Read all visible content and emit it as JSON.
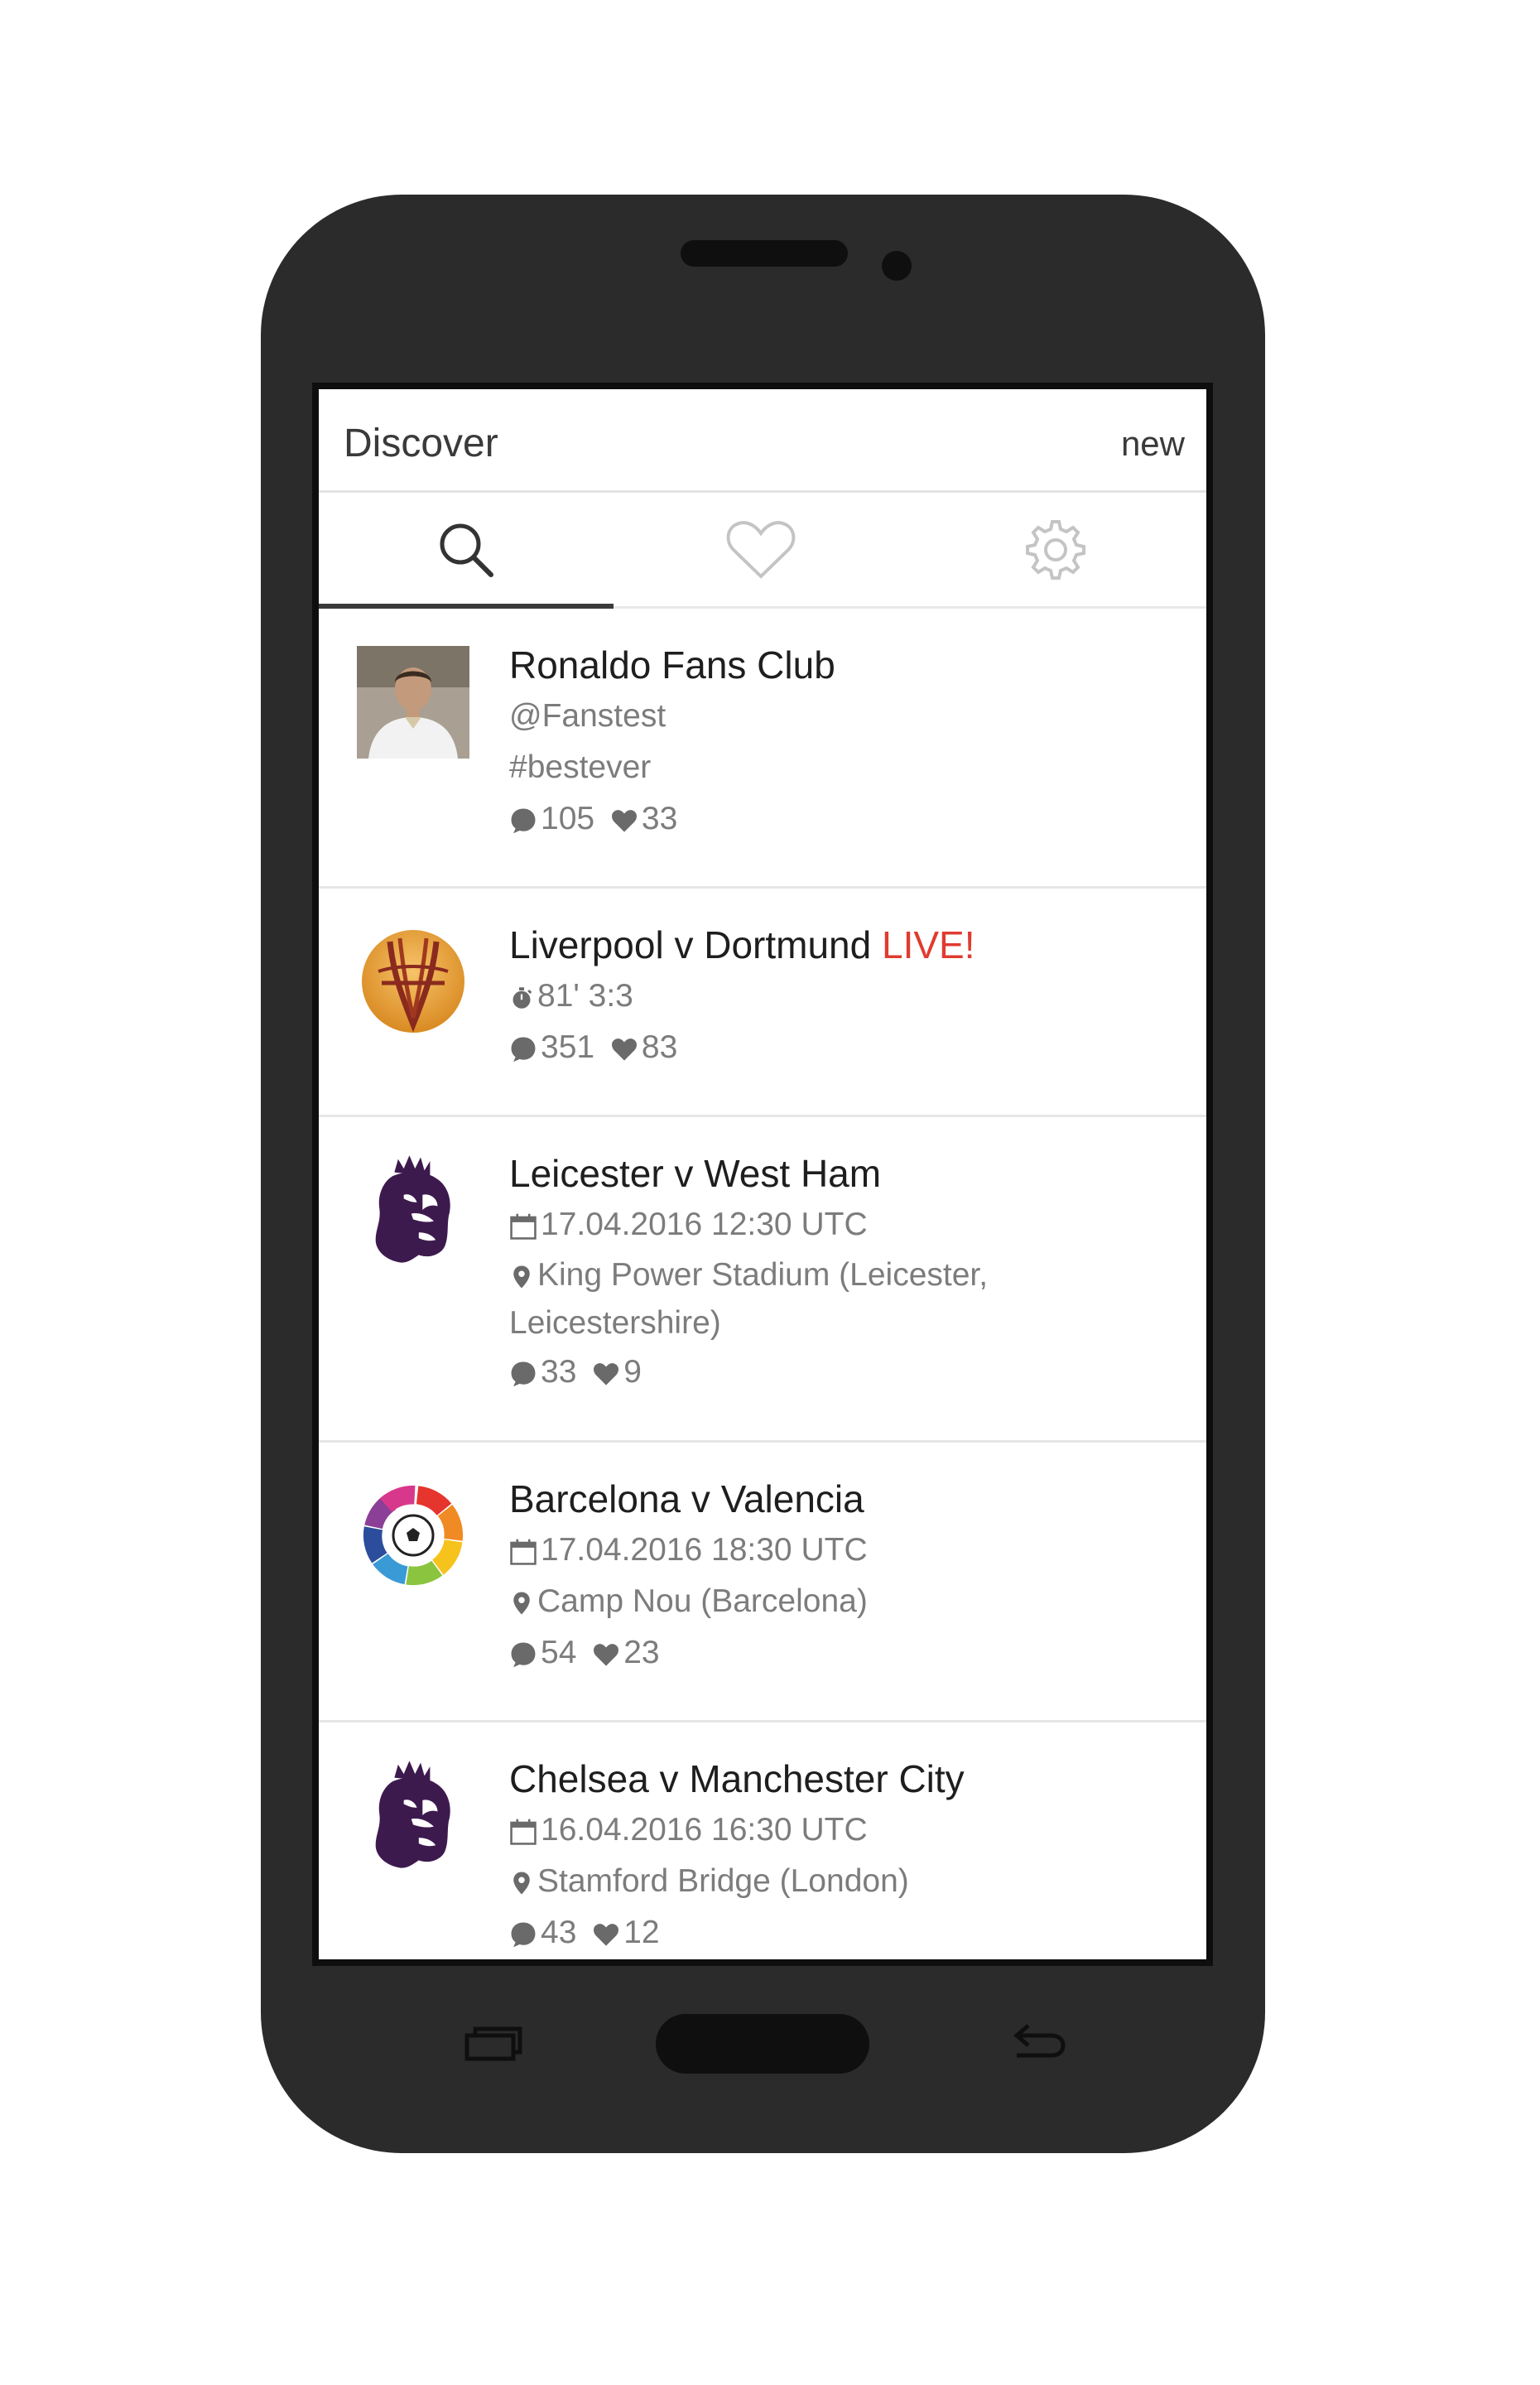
{
  "app": {
    "title": "Discover",
    "new_label": "new"
  },
  "tabs": [
    {
      "icon": "search-icon",
      "active": true
    },
    {
      "icon": "heart-outline-icon",
      "active": false
    },
    {
      "icon": "gear-icon",
      "active": false
    }
  ],
  "feed": [
    {
      "name": "Ronaldo Fans Club",
      "handle": "@Fanstest",
      "tag": "#bestever",
      "comments": "105",
      "likes": "33",
      "logo": "ronaldo-avatar"
    },
    {
      "name": "Liverpool v Dortmund",
      "live": "LIVE!",
      "clock": "81' 3:3",
      "comments": "351",
      "likes": "83",
      "logo": "europa-league-logo"
    },
    {
      "name": "Leicester v West Ham",
      "date": "17.04.2016 12:30 UTC",
      "venue": "King Power Stadium (Leicester, Leicestershire)",
      "comments": "33",
      "likes": "9",
      "logo": "premier-league-logo"
    },
    {
      "name": "Barcelona v Valencia",
      "date": "17.04.2016 18:30 UTC",
      "venue": "Camp Nou (Barcelona)",
      "comments": "54",
      "likes": "23",
      "logo": "la-liga-logo"
    },
    {
      "name": "Chelsea v Manchester City",
      "date": "16.04.2016 16:30 UTC",
      "venue": "Stamford Bridge (London)",
      "comments": "43",
      "likes": "12",
      "logo": "premier-league-logo"
    }
  ],
  "colors": {
    "phone_body": "#2b2b2b",
    "live_red": "#e03b2f",
    "text_dark": "#1e1e1e",
    "text_muted": "#7c7c7c",
    "premier_league_purple": "#3d1a4e"
  }
}
